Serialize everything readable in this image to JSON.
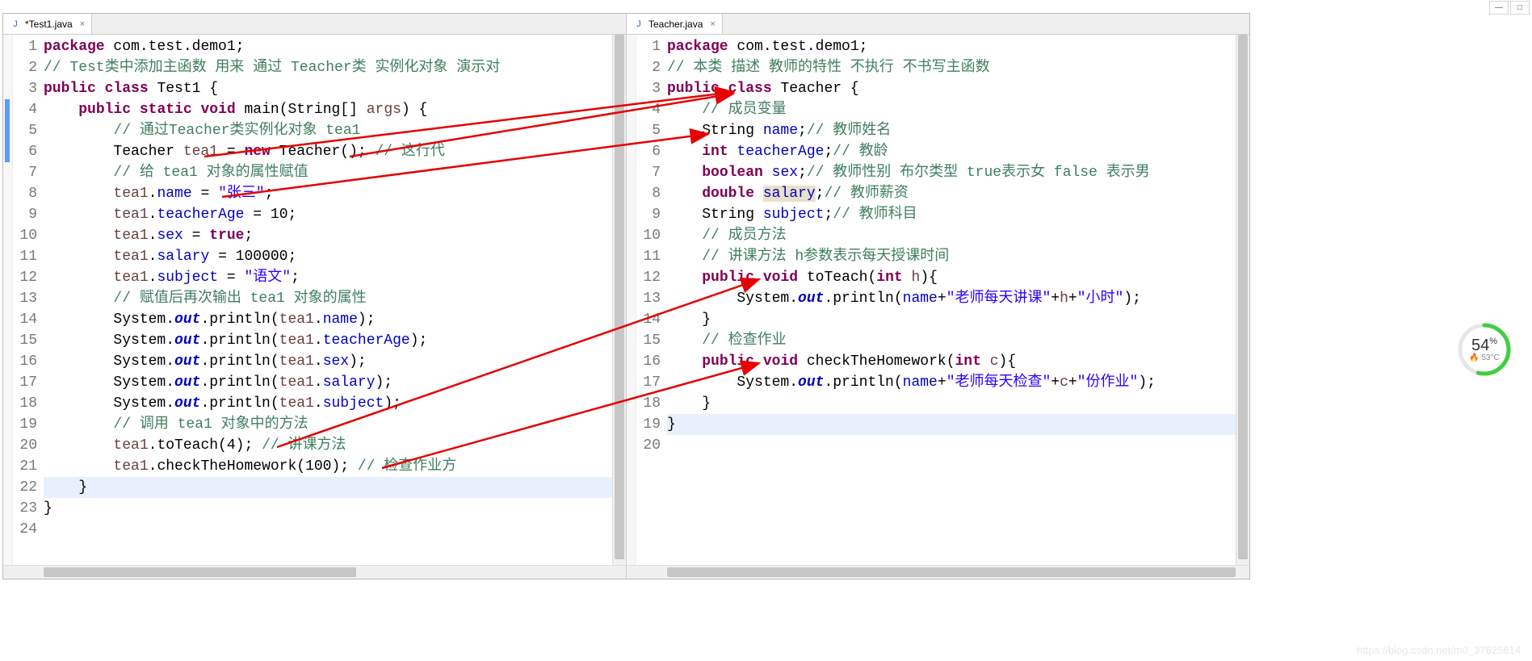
{
  "window": {
    "minimize": "—",
    "maximize": "□",
    "close": ""
  },
  "left": {
    "tab": {
      "icon": "J",
      "label": "*Test1.java",
      "close": "×"
    },
    "lines": 24,
    "highlightLine": 22,
    "code": [
      [
        [
          "kw",
          "package"
        ],
        [
          "p",
          " com.test.demo1;"
        ]
      ],
      [
        [
          "cm",
          "// Test类中添加主函数 用来 通过 Teacher类 实例化对象 演示对"
        ]
      ],
      [
        [
          "kw",
          "public"
        ],
        [
          "p",
          " "
        ],
        [
          "kw",
          "class"
        ],
        [
          "p",
          " Test1 {"
        ]
      ],
      [
        [
          "p",
          "    "
        ],
        [
          "kw",
          "public"
        ],
        [
          "p",
          " "
        ],
        [
          "kw",
          "static"
        ],
        [
          "p",
          " "
        ],
        [
          "kw",
          "void"
        ],
        [
          "p",
          " main(String[] "
        ],
        [
          "lvar",
          "args"
        ],
        [
          "p",
          ") {"
        ]
      ],
      [
        [
          "p",
          "        "
        ],
        [
          "cm",
          "// 通过Teacher类实例化对象 tea1"
        ]
      ],
      [
        [
          "p",
          "        Teacher "
        ],
        [
          "lvar",
          "tea1"
        ],
        [
          "p",
          " = "
        ],
        [
          "kw",
          "new"
        ],
        [
          "p",
          " Teacher(); "
        ],
        [
          "cm",
          "// 这行代"
        ]
      ],
      [
        [
          "p",
          "        "
        ],
        [
          "cm",
          "// 给 tea1 对象的属性赋值"
        ]
      ],
      [
        [
          "p",
          "        "
        ],
        [
          "lvar",
          "tea1"
        ],
        [
          "p",
          "."
        ],
        [
          "fld",
          "name"
        ],
        [
          "p",
          " = "
        ],
        [
          "str",
          "\"张三\""
        ],
        [
          "p",
          ";"
        ]
      ],
      [
        [
          "p",
          "        "
        ],
        [
          "lvar",
          "tea1"
        ],
        [
          "p",
          "."
        ],
        [
          "fld",
          "teacherAge"
        ],
        [
          "p",
          " = 10;"
        ]
      ],
      [
        [
          "p",
          "        "
        ],
        [
          "lvar",
          "tea1"
        ],
        [
          "p",
          "."
        ],
        [
          "fld",
          "sex"
        ],
        [
          "p",
          " = "
        ],
        [
          "kw",
          "true"
        ],
        [
          "p",
          ";"
        ]
      ],
      [
        [
          "p",
          "        "
        ],
        [
          "lvar",
          "tea1"
        ],
        [
          "p",
          "."
        ],
        [
          "fld",
          "salary"
        ],
        [
          "p",
          " = 100000;"
        ]
      ],
      [
        [
          "p",
          "        "
        ],
        [
          "lvar",
          "tea1"
        ],
        [
          "p",
          "."
        ],
        [
          "fld",
          "subject"
        ],
        [
          "p",
          " = "
        ],
        [
          "str",
          "\"语文\""
        ],
        [
          "p",
          ";"
        ]
      ],
      [
        [
          "p",
          "        "
        ],
        [
          "cm",
          "// 赋值后再次输出 tea1 对象的属性"
        ]
      ],
      [
        [
          "p",
          "        System."
        ],
        [
          "sfld",
          "out"
        ],
        [
          "p",
          ".println("
        ],
        [
          "lvar",
          "tea1"
        ],
        [
          "p",
          "."
        ],
        [
          "fld",
          "name"
        ],
        [
          "p",
          ");"
        ]
      ],
      [
        [
          "p",
          "        System."
        ],
        [
          "sfld",
          "out"
        ],
        [
          "p",
          ".println("
        ],
        [
          "lvar",
          "tea1"
        ],
        [
          "p",
          "."
        ],
        [
          "fld",
          "teacherAge"
        ],
        [
          "p",
          ");"
        ]
      ],
      [
        [
          "p",
          "        System."
        ],
        [
          "sfld",
          "out"
        ],
        [
          "p",
          ".println("
        ],
        [
          "lvar",
          "tea1"
        ],
        [
          "p",
          "."
        ],
        [
          "fld",
          "sex"
        ],
        [
          "p",
          ");"
        ]
      ],
      [
        [
          "p",
          "        System."
        ],
        [
          "sfld",
          "out"
        ],
        [
          "p",
          ".println("
        ],
        [
          "lvar",
          "tea1"
        ],
        [
          "p",
          "."
        ],
        [
          "fld",
          "salary"
        ],
        [
          "p",
          ");"
        ]
      ],
      [
        [
          "p",
          "        System."
        ],
        [
          "sfld",
          "out"
        ],
        [
          "p",
          ".println("
        ],
        [
          "lvar",
          "tea1"
        ],
        [
          "p",
          "."
        ],
        [
          "fld",
          "subject"
        ],
        [
          "p",
          ");"
        ]
      ],
      [
        [
          "p",
          "        "
        ],
        [
          "cm",
          "// 调用 tea1 对象中的方法"
        ]
      ],
      [
        [
          "p",
          "        "
        ],
        [
          "lvar",
          "tea1"
        ],
        [
          "p",
          ".toTeach(4); "
        ],
        [
          "cm",
          "// 讲课方法"
        ]
      ],
      [
        [
          "p",
          "        "
        ],
        [
          "lvar",
          "tea1"
        ],
        [
          "p",
          ".checkTheHomework(100); "
        ],
        [
          "cm",
          "// 检查作业方"
        ]
      ],
      [
        [
          "p",
          "    }"
        ]
      ],
      [
        [
          "p",
          "}"
        ]
      ],
      [
        [
          "p",
          ""
        ]
      ]
    ]
  },
  "right": {
    "tab": {
      "icon": "J",
      "label": "Teacher.java",
      "close": "×"
    },
    "lines": 20,
    "highlightLine": 19,
    "code": [
      [
        [
          "kw",
          "package"
        ],
        [
          "p",
          " com.test.demo1;"
        ]
      ],
      [
        [
          "cm",
          "// 本类 描述 教师的特性 不执行 不书写主函数"
        ]
      ],
      [
        [
          "kw",
          "public"
        ],
        [
          "p",
          " "
        ],
        [
          "kw",
          "class"
        ],
        [
          "p",
          " Teacher {"
        ]
      ],
      [
        [
          "p",
          "    "
        ],
        [
          "cm",
          "// 成员变量"
        ]
      ],
      [
        [
          "p",
          "    String "
        ],
        [
          "fld",
          "name"
        ],
        [
          "p",
          ";"
        ],
        [
          "cm",
          "// 教师姓名"
        ]
      ],
      [
        [
          "p",
          "    "
        ],
        [
          "kw",
          "int"
        ],
        [
          "p",
          " "
        ],
        [
          "fld",
          "teacherAge"
        ],
        [
          "p",
          ";"
        ],
        [
          "cm",
          "// 教龄"
        ]
      ],
      [
        [
          "p",
          "    "
        ],
        [
          "kw",
          "boolean"
        ],
        [
          "p",
          " "
        ],
        [
          "fld",
          "sex"
        ],
        [
          "p",
          ";"
        ],
        [
          "cm",
          "// 教师性别 布尔类型 true表示女 false 表示男"
        ]
      ],
      [
        [
          "p",
          "    "
        ],
        [
          "kw",
          "double"
        ],
        [
          "p",
          " "
        ],
        [
          "fld",
          "salary"
        ],
        [
          "hl-end",
          ""
        ],
        [
          "p",
          ";"
        ],
        [
          "cm",
          "// 教师薪资"
        ]
      ],
      [
        [
          "p",
          "    String "
        ],
        [
          "fld",
          "subject"
        ],
        [
          "p",
          ";"
        ],
        [
          "cm",
          "// 教师科目"
        ]
      ],
      [
        [
          "p",
          "    "
        ],
        [
          "cm",
          "// 成员方法"
        ]
      ],
      [
        [
          "p",
          "    "
        ],
        [
          "cm",
          "// 讲课方法 h参数表示每天授课时间"
        ]
      ],
      [
        [
          "p",
          "    "
        ],
        [
          "kw",
          "public"
        ],
        [
          "p",
          " "
        ],
        [
          "kw",
          "void"
        ],
        [
          "p",
          " toTeach("
        ],
        [
          "kw",
          "int"
        ],
        [
          "p",
          " "
        ],
        [
          "lvar",
          "h"
        ],
        [
          "p",
          "){"
        ]
      ],
      [
        [
          "p",
          "        System."
        ],
        [
          "sfld",
          "out"
        ],
        [
          "p",
          ".println("
        ],
        [
          "fld",
          "name"
        ],
        [
          "p",
          "+"
        ],
        [
          "str",
          "\"老师每天讲课\""
        ],
        [
          "p",
          "+"
        ],
        [
          "lvar",
          "h"
        ],
        [
          "p",
          "+"
        ],
        [
          "str",
          "\"小时\""
        ],
        [
          "p",
          ");"
        ]
      ],
      [
        [
          "p",
          "    }"
        ]
      ],
      [
        [
          "p",
          "    "
        ],
        [
          "cm",
          "// 检查作业"
        ]
      ],
      [
        [
          "p",
          "    "
        ],
        [
          "kw",
          "public"
        ],
        [
          "p",
          " "
        ],
        [
          "kw",
          "void"
        ],
        [
          "p",
          " checkTheHomework("
        ],
        [
          "kw",
          "int"
        ],
        [
          "p",
          " "
        ],
        [
          "lvar",
          "c"
        ],
        [
          "p",
          "){"
        ]
      ],
      [
        [
          "p",
          "        System."
        ],
        [
          "sfld",
          "out"
        ],
        [
          "p",
          ".println("
        ],
        [
          "fld",
          "name"
        ],
        [
          "p",
          "+"
        ],
        [
          "str",
          "\"老师每天检查\""
        ],
        [
          "p",
          "+"
        ],
        [
          "lvar",
          "c"
        ],
        [
          "p",
          "+"
        ],
        [
          "str",
          "\"份作业\""
        ],
        [
          "p",
          ");"
        ]
      ],
      [
        [
          "p",
          "    }"
        ]
      ],
      [
        [
          "p",
          "}"
        ]
      ],
      [
        [
          "p",
          ""
        ]
      ]
    ]
  },
  "badge": {
    "percent": "54",
    "percentSuffix": "%",
    "temp": "53°C",
    "tempIcon": "🔥"
  },
  "watermark": "https://blog.csdn.net/m0_37625614"
}
